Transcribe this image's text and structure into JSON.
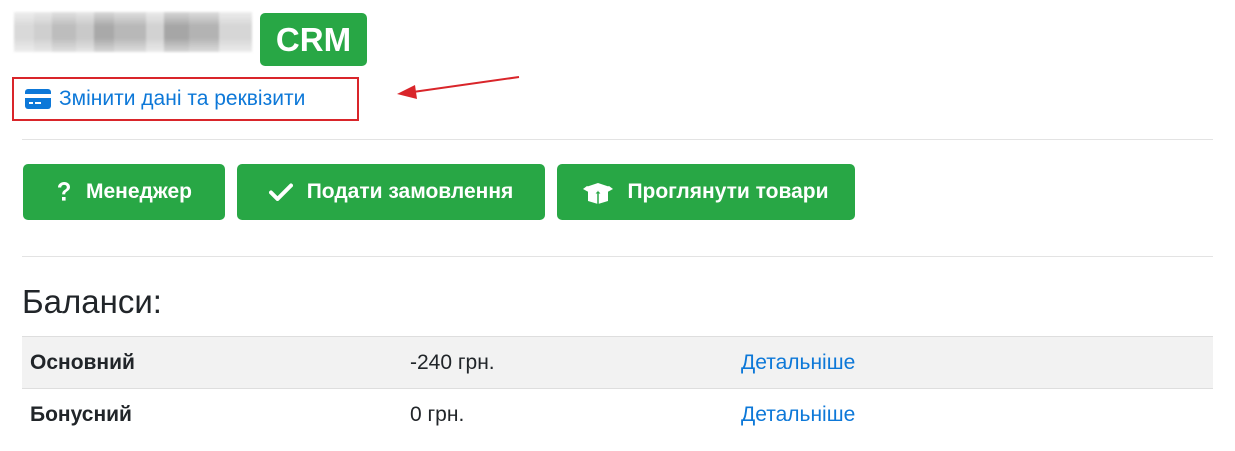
{
  "header": {
    "badge": "CRM",
    "edit_link": "Змінити дані та реквізити"
  },
  "actions": {
    "manager": "Менеджер",
    "submit_order": "Подати замовлення",
    "view_products": "Проглянути товари"
  },
  "balances": {
    "title": "Баланси:",
    "rows": [
      {
        "name": "Основний",
        "amount": "-240 грн.",
        "link": "Детальніше"
      },
      {
        "name": "Бонусний",
        "amount": "0 грн.",
        "link": "Детальніше"
      }
    ]
  },
  "colors": {
    "accent_green": "#28a745",
    "link_blue": "#0d78d8",
    "highlight_red": "#d9252a"
  },
  "icons": {
    "edit_link": "credit-card-icon",
    "manager": "question-icon",
    "submit_order": "check-icon",
    "view_products": "box-open-icon"
  }
}
